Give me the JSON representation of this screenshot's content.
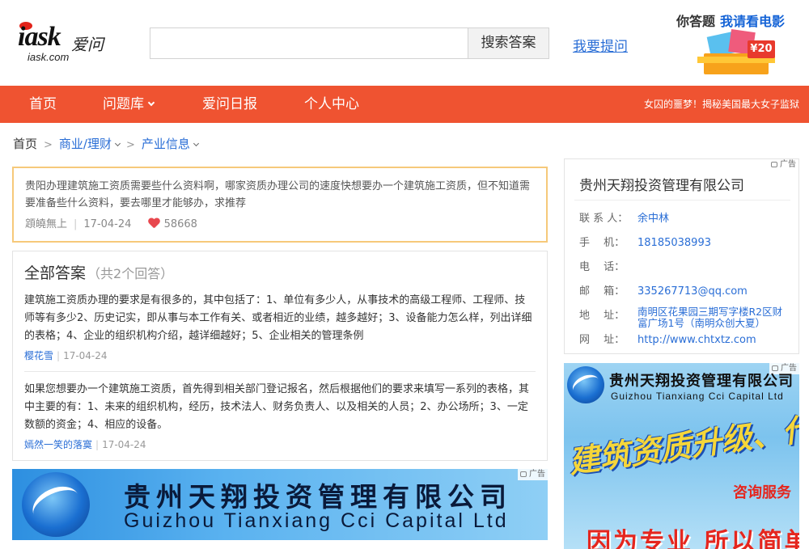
{
  "header": {
    "logo_mark": "iask",
    "logo_cn": "爱问",
    "logo_domain": "iask.com",
    "search_placeholder": "",
    "search_button": "搜索答案",
    "ask_link": "我要提问",
    "promo_a": "你答题",
    "promo_b": "我请看电影",
    "promo_price": "¥20"
  },
  "nav": {
    "items": [
      {
        "label": "首页",
        "has_caret": false
      },
      {
        "label": "问题库",
        "has_caret": true
      },
      {
        "label": "爱问日报",
        "has_caret": false
      },
      {
        "label": "个人中心",
        "has_caret": false
      }
    ],
    "news": "女囚的噩梦！揭秘美国最大女子监狱"
  },
  "breadcrumb": {
    "home": "首页",
    "sep": ">",
    "level1": "商业/理财",
    "level2": "产业信息"
  },
  "question": {
    "text": "贵阳办理建筑施工资质需要些什么资料啊，哪家资质办理公司的速度快想要办一个建筑施工资质，但不知道需要准备些什么资料，要去哪里才能够办，求推荐",
    "user": "顁皢無上",
    "date": "17-04-24",
    "likes": "58668"
  },
  "answers": {
    "title": "全部答案",
    "count_text": "（共2个回答）",
    "list": [
      {
        "text": "建筑施工资质办理的要求是有很多的，其中包括了：1、单位有多少人，从事技术的高级工程师、工程师、技师等有多少2、历史记实，即从事与本工作有关、或者相近的业绩，越多越好；3、设备能力怎么样，列出详细的表格；4、企业的组织机构介绍，越详细越好；5、企业相关的管理条例",
        "user": "樱花雪",
        "date": "17-04-24"
      },
      {
        "text": "如果您想要办一个建筑施工资质，首先得到相关部门登记报名，然后根据他们的要求来填写一系列的表格，其中主要的有：1、未来的组织机构，经历，技术法人、财务负责人、以及相关的人员；2、办公场所；3、一定数额的资金；4、相应的设备。",
        "user": "嫣然一笑的落寞",
        "date": "17-04-24"
      }
    ]
  },
  "ad_banner": {
    "cn_name": "贵州天翔投资管理有限公司",
    "en_name": "Guizhou Tianxiang Cci Capital Ltd",
    "tag": "广告"
  },
  "company": {
    "title": "贵州天翔投资管理有限公司",
    "rows": [
      {
        "k": "联 系 人：",
        "v": "余中林"
      },
      {
        "k": "手　 机：",
        "v": "18185038993"
      },
      {
        "k": "电　 话：",
        "v": ""
      },
      {
        "k": "邮　 箱：",
        "v": "335267713@qq.com"
      },
      {
        "k": "地　 址：",
        "v": "南明区花果园三期写字楼R2区财富广场1号（南明众创大夏）"
      },
      {
        "k": "网　 址：",
        "v": "http://www.chtxtz.com"
      }
    ],
    "tag": "广告"
  },
  "ad_side": {
    "cn_name": "贵州天翔投资管理有限公司",
    "en_name": "Guizhou Tianxiang Cci Capital Ltd",
    "slogan": "建筑资质升级、代办",
    "consult": "咨询服务",
    "bottom": "因为专业 所以简单!",
    "tag": "广告"
  }
}
